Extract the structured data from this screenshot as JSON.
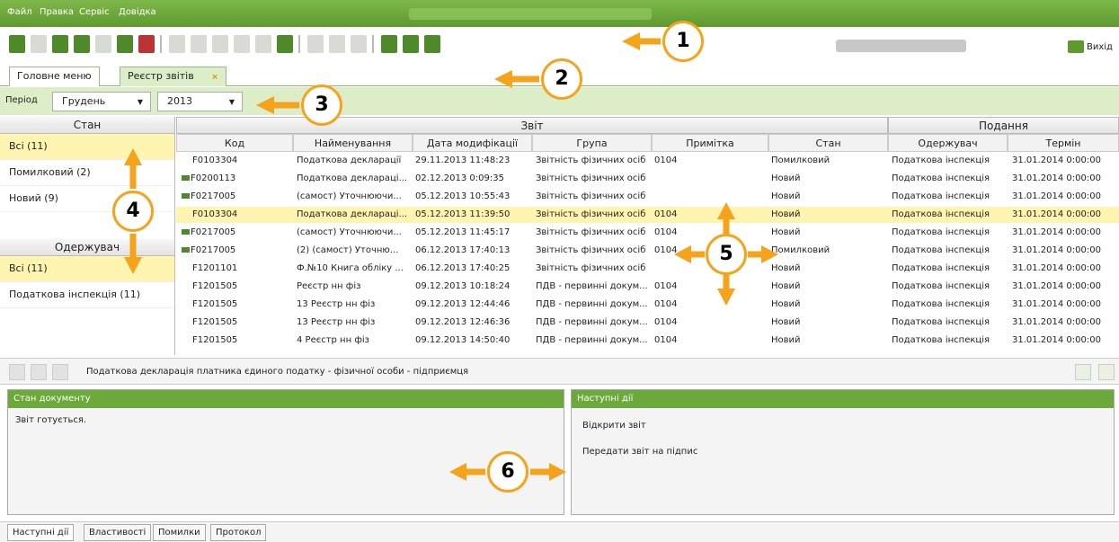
{
  "menu": {
    "file": "Файл",
    "edit": "Правка",
    "service": "Сервіс",
    "help": "Довідка"
  },
  "toolbar": {
    "exit_label": "Вихід"
  },
  "tabs": [
    {
      "label": "Головне меню"
    },
    {
      "label": "Реєстр звітів",
      "close": "×"
    }
  ],
  "period": {
    "label": "Період",
    "month": "Грудень",
    "year": "2013"
  },
  "state_panel": {
    "header": "Стан",
    "items": [
      "Всі (11)",
      "Помилковий (2)",
      "Новий (9)"
    ],
    "recipient_header": "Одержувач",
    "recipient_items": [
      "Всі (11)",
      "Податкова інспекція (11)"
    ]
  },
  "grid": {
    "group_report": "Звіт",
    "group_submission": "Подання",
    "columns": [
      "Код",
      "Найменування",
      "Дата модифікації",
      "Група",
      "Примітка",
      "Стан",
      "Одержувач",
      "Термін"
    ],
    "rows": [
      {
        "code": "F0103304",
        "name": "Податкова декларації",
        "date": "29.11.2013 11:48:23",
        "group": "Звітність фізичних осіб",
        "note": "0104",
        "state": "Помилковий",
        "recipient": "Податкова інспекція",
        "term": "31.01.2014 0:00:00",
        "folder": false
      },
      {
        "code": "F0200113",
        "name": "Податкова деклараці...",
        "date": "02.12.2013 0:09:35",
        "group": "Звітність фізичних осіб",
        "note": "",
        "state": "Новий",
        "recipient": "Податкова інспекція",
        "term": "31.01.2014 0:00:00",
        "folder": true
      },
      {
        "code": "F0217005",
        "name": "(самост) Уточнюючи...",
        "date": "05.12.2013 10:55:43",
        "group": "Звітність фізичних осіб",
        "note": "",
        "state": "Новий",
        "recipient": "Податкова інспекція",
        "term": "31.01.2014 0:00:00",
        "folder": true
      },
      {
        "code": "F0103304",
        "name": "Податкова деклараці...",
        "date": "05.12.2013 11:39:50",
        "group": "Звітність фізичних осіб",
        "note": "0104",
        "state": "Новий",
        "recipient": "Податкова інспекція",
        "term": "31.01.2014 0:00:00",
        "folder": false,
        "selected": true
      },
      {
        "code": "F0217005",
        "name": "(самост) Уточнюючи...",
        "date": "05.12.2013 11:45:17",
        "group": "Звітність фізичних осіб",
        "note": "0104",
        "state": "Новий",
        "recipient": "Податкова інспекція",
        "term": "31.01.2014 0:00:00",
        "folder": true
      },
      {
        "code": "F0217005",
        "name": "(2) (самост) Уточню...",
        "date": "06.12.2013 17:40:13",
        "group": "Звітність фізичних осіб",
        "note": "0104",
        "state": "Помилковий",
        "recipient": "Податкова інспекція",
        "term": "31.01.2014 0:00:00",
        "folder": true
      },
      {
        "code": "F1201101",
        "name": "Ф.№10 Книга обліку ...",
        "date": "06.12.2013 17:40:25",
        "group": "Звітність фізичних осіб",
        "note": "",
        "state": "Новий",
        "recipient": "Податкова інспекція",
        "term": "31.01.2014 0:00:00",
        "folder": false
      },
      {
        "code": "F1201505",
        "name": "Реєстр нн фіз",
        "date": "09.12.2013 10:18:24",
        "group": "ПДВ - первинні докум...",
        "note": "0104",
        "state": "Новий",
        "recipient": "Податкова інспекція",
        "term": "31.01.2014 0:00:00",
        "folder": false
      },
      {
        "code": "F1201505",
        "name": "13 Реєстр нн фіз",
        "date": "09.12.2013 12:44:46",
        "group": "ПДВ - первинні докум...",
        "note": "0104",
        "state": "Новий",
        "recipient": "Податкова інспекція",
        "term": "31.01.2014 0:00:00",
        "folder": false
      },
      {
        "code": "F1201505",
        "name": "13 Реєстр нн фіз",
        "date": "09.12.2013 12:46:36",
        "group": "ПДВ - первинні докум...",
        "note": "0104",
        "state": "Новий",
        "recipient": "Податкова інспекція",
        "term": "31.01.2014 0:00:00",
        "folder": false
      },
      {
        "code": "F1201505",
        "name": "4 Реєстр нн фіз",
        "date": "09.12.2013 14:50:40",
        "group": "ПДВ - первинні докум...",
        "note": "0104",
        "state": "Новий",
        "recipient": "Податкова інспекція",
        "term": "31.01.2014 0:00:00",
        "folder": false
      }
    ]
  },
  "details": {
    "title": "Податкова декларація платника єдиного податку - фізичної особи - підприємця"
  },
  "doc_state": {
    "header": "Стан документу",
    "text": "Звіт готується."
  },
  "next_actions": {
    "header": "Наступні дії",
    "open": "Відкрити звіт",
    "send": "Передати звіт на підпис"
  },
  "bottom_tabs": [
    "Наступні дії",
    "Властивості",
    "Помилки",
    "Протокол"
  ],
  "callouts": [
    "1",
    "2",
    "3",
    "4",
    "5",
    "6"
  ],
  "colors": {
    "accent": "#6aa93a",
    "callout": "#f5a31a",
    "selected_row": "#fff5b0"
  }
}
